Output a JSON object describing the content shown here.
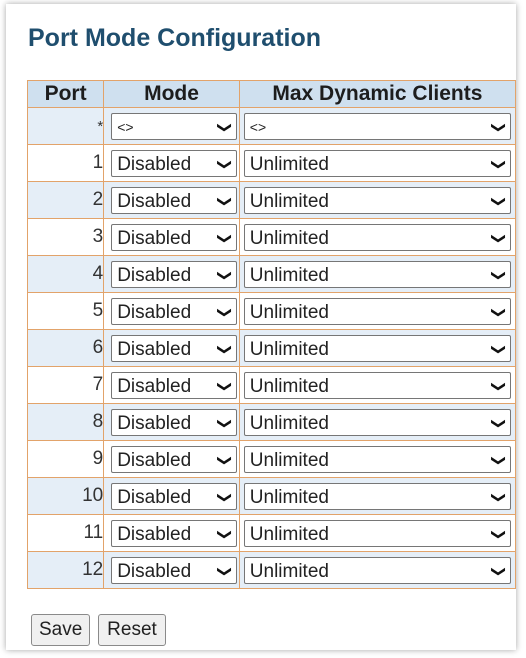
{
  "page": {
    "title": "Port Mode Configuration"
  },
  "table": {
    "headers": {
      "port": "Port",
      "mode": "Mode",
      "max": "Max Dynamic Clients"
    },
    "wildcard": {
      "port": "*",
      "mode": "<>",
      "max": "<>"
    },
    "rows": [
      {
        "port": "1",
        "mode": "Disabled",
        "max": "Unlimited"
      },
      {
        "port": "2",
        "mode": "Disabled",
        "max": "Unlimited"
      },
      {
        "port": "3",
        "mode": "Disabled",
        "max": "Unlimited"
      },
      {
        "port": "4",
        "mode": "Disabled",
        "max": "Unlimited"
      },
      {
        "port": "5",
        "mode": "Disabled",
        "max": "Unlimited"
      },
      {
        "port": "6",
        "mode": "Disabled",
        "max": "Unlimited"
      },
      {
        "port": "7",
        "mode": "Disabled",
        "max": "Unlimited"
      },
      {
        "port": "8",
        "mode": "Disabled",
        "max": "Unlimited"
      },
      {
        "port": "9",
        "mode": "Disabled",
        "max": "Unlimited"
      },
      {
        "port": "10",
        "mode": "Disabled",
        "max": "Unlimited"
      },
      {
        "port": "11",
        "mode": "Disabled",
        "max": "Unlimited"
      },
      {
        "port": "12",
        "mode": "Disabled",
        "max": "Unlimited"
      }
    ]
  },
  "buttons": {
    "save": "Save",
    "reset": "Reset"
  },
  "colors": {
    "title": "#1f4e6e",
    "header_bg": "#cfe0ef",
    "row_alt_bg": "#e5eef7",
    "border": "#e2a36a"
  }
}
